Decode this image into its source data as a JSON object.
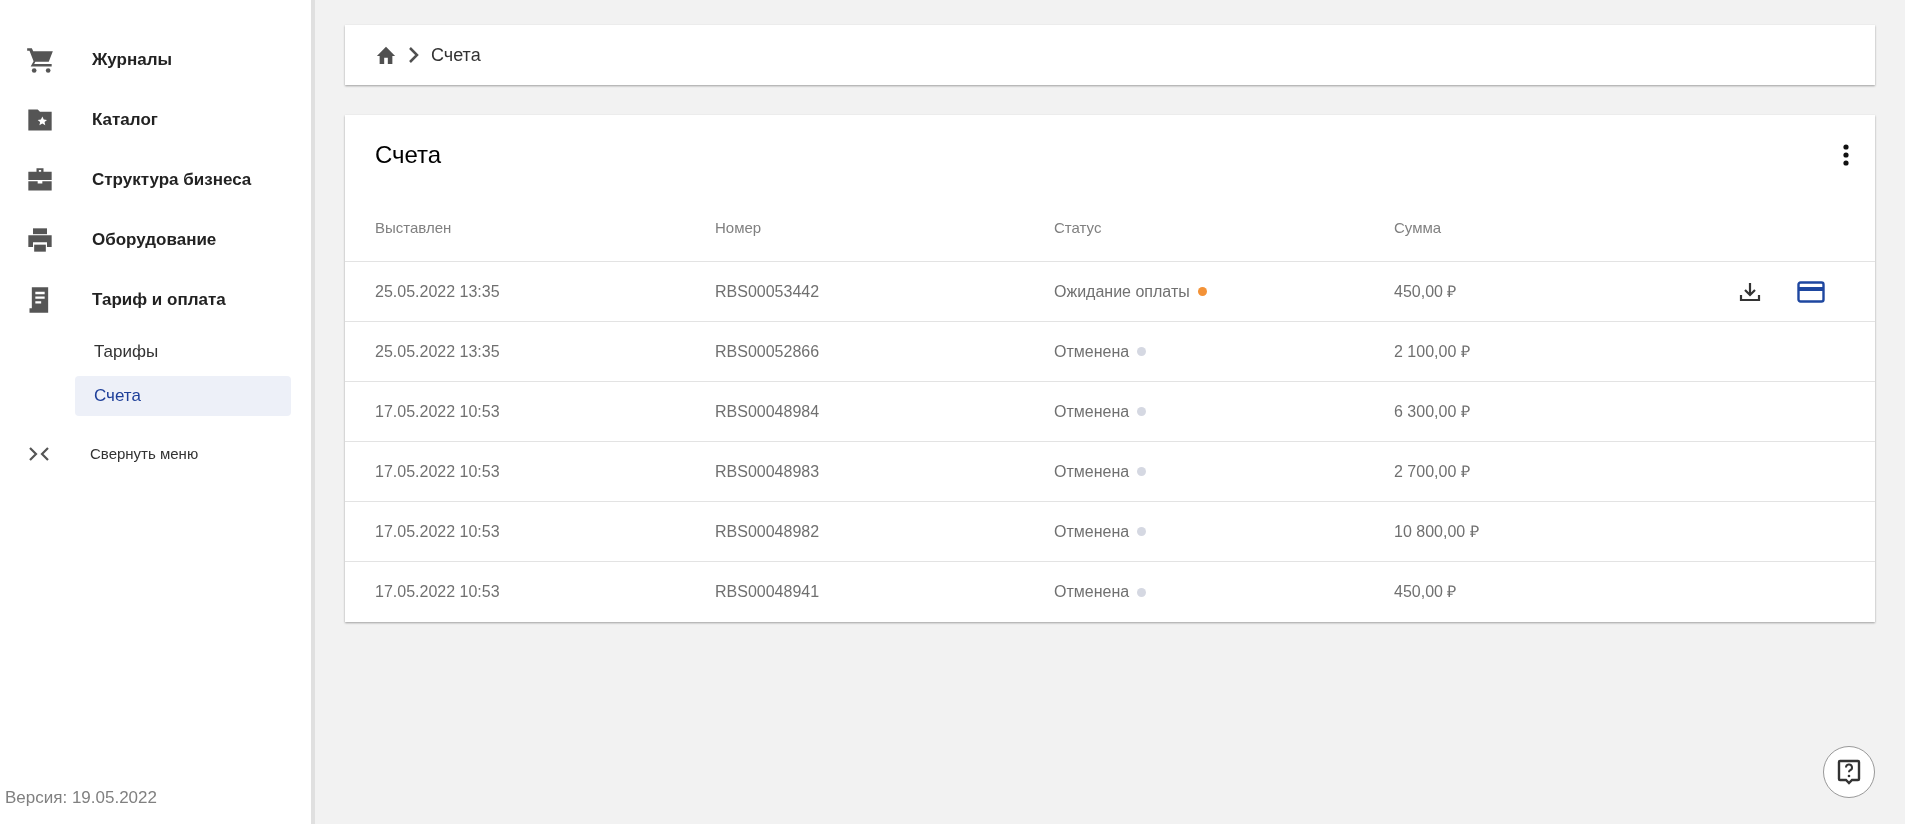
{
  "sidebar": {
    "items": [
      {
        "label": "Журналы"
      },
      {
        "label": "Каталог"
      },
      {
        "label": "Структура бизнеса"
      },
      {
        "label": "Оборудование"
      },
      {
        "label": "Тариф и оплата",
        "children": [
          {
            "label": "Тарифы",
            "selected": false
          },
          {
            "label": "Счета",
            "selected": true
          }
        ]
      }
    ],
    "collapse_label": "Свернуть меню",
    "version": "Версия: 19.05.2022"
  },
  "breadcrumb": {
    "current": "Счета"
  },
  "table": {
    "title": "Счета",
    "columns": [
      "Выставлен",
      "Номер",
      "Статус",
      "Сумма"
    ],
    "rows": [
      {
        "date": "25.05.2022 13:35",
        "number": "RBS00053442",
        "status": "Ожидание оплаты",
        "color": "#f39237",
        "amount": "450,00 ₽",
        "actions": true
      },
      {
        "date": "25.05.2022 13:35",
        "number": "RBS00052866",
        "status": "Отменена",
        "color": "#d5d8e2",
        "amount": "2 100,00 ₽",
        "actions": false
      },
      {
        "date": "17.05.2022 10:53",
        "number": "RBS00048984",
        "status": "Отменена",
        "color": "#d5d8e2",
        "amount": "6 300,00 ₽",
        "actions": false
      },
      {
        "date": "17.05.2022 10:53",
        "number": "RBS00048983",
        "status": "Отменена",
        "color": "#d5d8e2",
        "amount": "2 700,00 ₽",
        "actions": false
      },
      {
        "date": "17.05.2022 10:53",
        "number": "RBS00048982",
        "status": "Отменена",
        "color": "#d5d8e2",
        "amount": "10 800,00 ₽",
        "actions": false
      },
      {
        "date": "17.05.2022 10:53",
        "number": "RBS00048941",
        "status": "Отменена",
        "color": "#d5d8e2",
        "amount": "450,00 ₽",
        "actions": false
      }
    ]
  }
}
